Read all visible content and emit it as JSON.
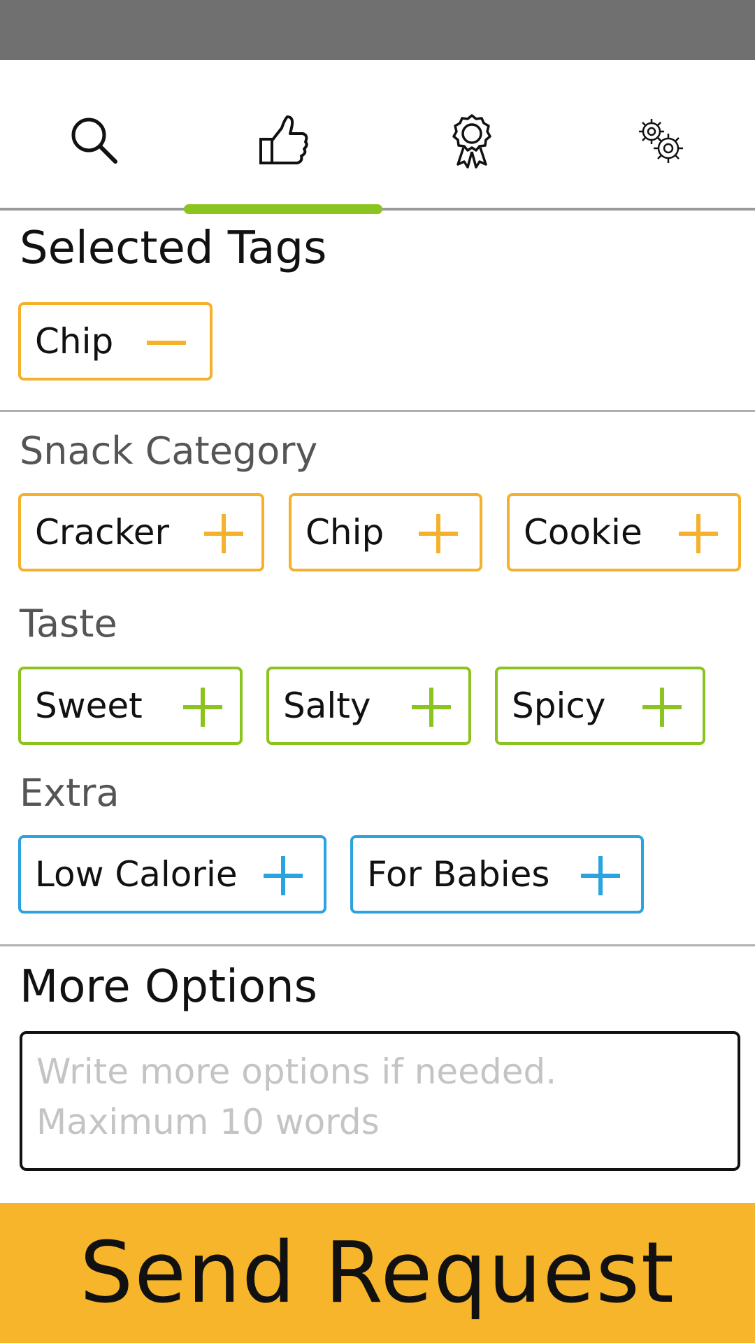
{
  "colors": {
    "status_bar": "#707070",
    "tab_indicator": "#8cc41f",
    "category_orange": "#f5b12b",
    "taste_green": "#8cc41f",
    "extra_blue": "#2aa3de",
    "send_button": "#f7b52c"
  },
  "tabs": [
    {
      "icon": "search-icon",
      "active": false
    },
    {
      "icon": "thumbs-up-icon",
      "active": true
    },
    {
      "icon": "award-ribbon-icon",
      "active": false
    },
    {
      "icon": "gears-icon",
      "active": false
    }
  ],
  "selected_tags": {
    "title": "Selected Tags",
    "items": [
      {
        "label": "Chip",
        "action_icon": "minus-icon"
      }
    ]
  },
  "snack_category": {
    "title": "Snack Category",
    "items": [
      {
        "label": "Cracker",
        "action_icon": "plus-icon"
      },
      {
        "label": "Chip",
        "action_icon": "plus-icon"
      },
      {
        "label": "Cookie",
        "action_icon": "plus-icon"
      }
    ]
  },
  "taste": {
    "title": "Taste",
    "items": [
      {
        "label": "Sweet",
        "action_icon": "plus-icon"
      },
      {
        "label": "Salty",
        "action_icon": "plus-icon"
      },
      {
        "label": "Spicy",
        "action_icon": "plus-icon"
      }
    ]
  },
  "extra": {
    "title": "Extra",
    "items": [
      {
        "label": "Low Calorie",
        "action_icon": "plus-icon"
      },
      {
        "label": "For Babies",
        "action_icon": "plus-icon"
      }
    ]
  },
  "more_options": {
    "title": "More Options",
    "placeholder_line1": "Write more options if needed.",
    "placeholder_line2": "Maximum 10 words"
  },
  "send_button": {
    "label": "Send Request"
  }
}
